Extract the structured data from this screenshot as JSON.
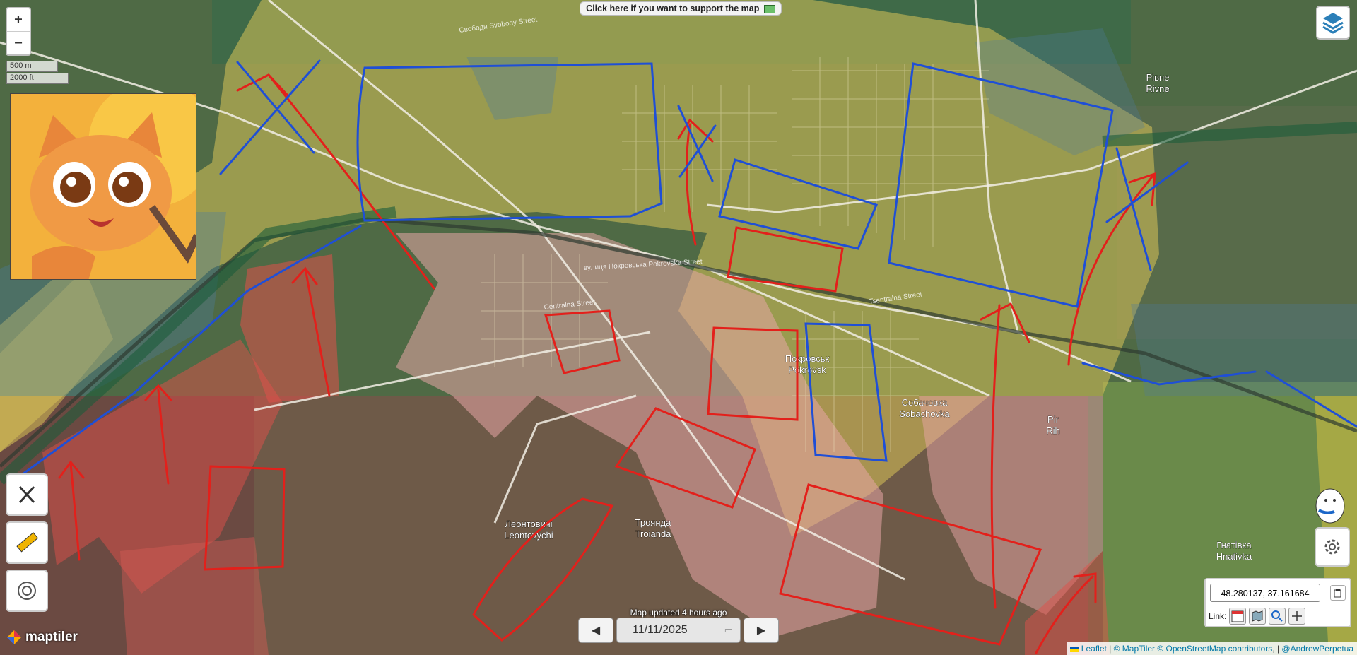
{
  "support_banner": "Click here if you want to support the map",
  "zoom": {
    "in": "+",
    "out": "−"
  },
  "scale": {
    "metric": "500 m",
    "imperial": "2000 ft"
  },
  "place_labels": [
    {
      "uk": "Покровськ",
      "en": "Pokrovsk"
    },
    {
      "uk": "Собачовка",
      "en": "Sobachovka"
    },
    {
      "uk": "Леонтовичі",
      "en": "Leontovychi"
    },
    {
      "uk": "Троянда",
      "en": "Troianda"
    },
    {
      "uk": "Рівне",
      "en": "Rivne"
    },
    {
      "uk": "Гнатівка",
      "en": "Hnativka"
    },
    {
      "uk": "Pir",
      "en": "Rih"
    }
  ],
  "streets": [
    "Свободи Svobody Street",
    "вулиця Покровська Pokrovska Street",
    "Centralna Street",
    "Tsentralna Street"
  ],
  "coordinates": "48.280137, 37.161684",
  "link_label": "Link:",
  "map_updated": "Map updated 4 hours ago",
  "date": "11/11/2025",
  "attribution": {
    "leaflet": "Leaflet",
    "maptiler": "© MapTiler",
    "osm": "© OpenStreetMap contributors",
    "author": "@AndrewPerpetua"
  },
  "brand": "maptiler",
  "icons": [
    "layers-icon",
    "x-logo-icon",
    "ruler-icon",
    "target-icon",
    "gear-icon",
    "calendar-icon",
    "map-icon",
    "search-icon",
    "crosshair-icon",
    "copy-icon",
    "prev-icon",
    "next-icon"
  ],
  "colors": {
    "control_zone": "#d9c257",
    "contested_red": "#e0504a",
    "ua_line": "#1f4fd6",
    "ru_arrow": "#e3201b"
  }
}
